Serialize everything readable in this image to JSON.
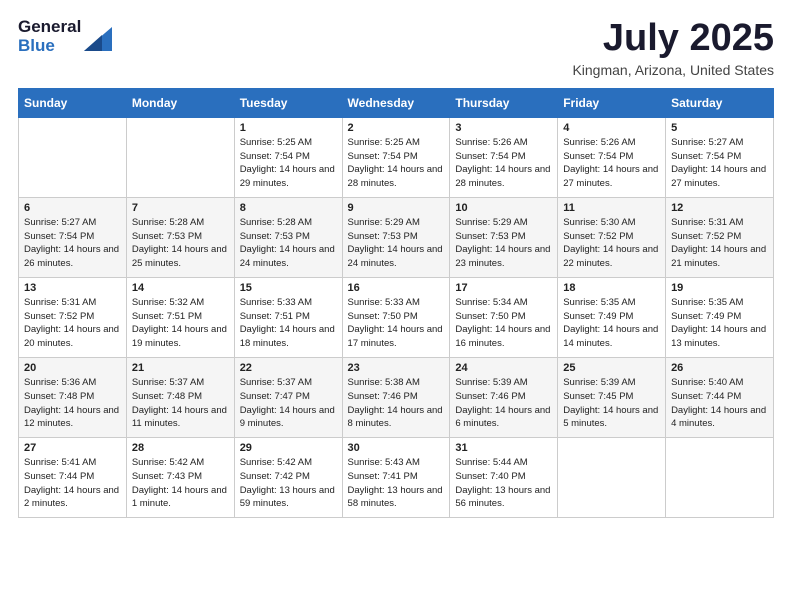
{
  "header": {
    "logo_general": "General",
    "logo_blue": "Blue",
    "month_title": "July 2025",
    "location": "Kingman, Arizona, United States"
  },
  "weekdays": [
    "Sunday",
    "Monday",
    "Tuesday",
    "Wednesday",
    "Thursday",
    "Friday",
    "Saturday"
  ],
  "weeks": [
    [
      {
        "day": "",
        "sunrise": "",
        "sunset": "",
        "daylight": ""
      },
      {
        "day": "",
        "sunrise": "",
        "sunset": "",
        "daylight": ""
      },
      {
        "day": "1",
        "sunrise": "Sunrise: 5:25 AM",
        "sunset": "Sunset: 7:54 PM",
        "daylight": "Daylight: 14 hours and 29 minutes."
      },
      {
        "day": "2",
        "sunrise": "Sunrise: 5:25 AM",
        "sunset": "Sunset: 7:54 PM",
        "daylight": "Daylight: 14 hours and 28 minutes."
      },
      {
        "day": "3",
        "sunrise": "Sunrise: 5:26 AM",
        "sunset": "Sunset: 7:54 PM",
        "daylight": "Daylight: 14 hours and 28 minutes."
      },
      {
        "day": "4",
        "sunrise": "Sunrise: 5:26 AM",
        "sunset": "Sunset: 7:54 PM",
        "daylight": "Daylight: 14 hours and 27 minutes."
      },
      {
        "day": "5",
        "sunrise": "Sunrise: 5:27 AM",
        "sunset": "Sunset: 7:54 PM",
        "daylight": "Daylight: 14 hours and 27 minutes."
      }
    ],
    [
      {
        "day": "6",
        "sunrise": "Sunrise: 5:27 AM",
        "sunset": "Sunset: 7:54 PM",
        "daylight": "Daylight: 14 hours and 26 minutes."
      },
      {
        "day": "7",
        "sunrise": "Sunrise: 5:28 AM",
        "sunset": "Sunset: 7:53 PM",
        "daylight": "Daylight: 14 hours and 25 minutes."
      },
      {
        "day": "8",
        "sunrise": "Sunrise: 5:28 AM",
        "sunset": "Sunset: 7:53 PM",
        "daylight": "Daylight: 14 hours and 24 minutes."
      },
      {
        "day": "9",
        "sunrise": "Sunrise: 5:29 AM",
        "sunset": "Sunset: 7:53 PM",
        "daylight": "Daylight: 14 hours and 24 minutes."
      },
      {
        "day": "10",
        "sunrise": "Sunrise: 5:29 AM",
        "sunset": "Sunset: 7:53 PM",
        "daylight": "Daylight: 14 hours and 23 minutes."
      },
      {
        "day": "11",
        "sunrise": "Sunrise: 5:30 AM",
        "sunset": "Sunset: 7:52 PM",
        "daylight": "Daylight: 14 hours and 22 minutes."
      },
      {
        "day": "12",
        "sunrise": "Sunrise: 5:31 AM",
        "sunset": "Sunset: 7:52 PM",
        "daylight": "Daylight: 14 hours and 21 minutes."
      }
    ],
    [
      {
        "day": "13",
        "sunrise": "Sunrise: 5:31 AM",
        "sunset": "Sunset: 7:52 PM",
        "daylight": "Daylight: 14 hours and 20 minutes."
      },
      {
        "day": "14",
        "sunrise": "Sunrise: 5:32 AM",
        "sunset": "Sunset: 7:51 PM",
        "daylight": "Daylight: 14 hours and 19 minutes."
      },
      {
        "day": "15",
        "sunrise": "Sunrise: 5:33 AM",
        "sunset": "Sunset: 7:51 PM",
        "daylight": "Daylight: 14 hours and 18 minutes."
      },
      {
        "day": "16",
        "sunrise": "Sunrise: 5:33 AM",
        "sunset": "Sunset: 7:50 PM",
        "daylight": "Daylight: 14 hours and 17 minutes."
      },
      {
        "day": "17",
        "sunrise": "Sunrise: 5:34 AM",
        "sunset": "Sunset: 7:50 PM",
        "daylight": "Daylight: 14 hours and 16 minutes."
      },
      {
        "day": "18",
        "sunrise": "Sunrise: 5:35 AM",
        "sunset": "Sunset: 7:49 PM",
        "daylight": "Daylight: 14 hours and 14 minutes."
      },
      {
        "day": "19",
        "sunrise": "Sunrise: 5:35 AM",
        "sunset": "Sunset: 7:49 PM",
        "daylight": "Daylight: 14 hours and 13 minutes."
      }
    ],
    [
      {
        "day": "20",
        "sunrise": "Sunrise: 5:36 AM",
        "sunset": "Sunset: 7:48 PM",
        "daylight": "Daylight: 14 hours and 12 minutes."
      },
      {
        "day": "21",
        "sunrise": "Sunrise: 5:37 AM",
        "sunset": "Sunset: 7:48 PM",
        "daylight": "Daylight: 14 hours and 11 minutes."
      },
      {
        "day": "22",
        "sunrise": "Sunrise: 5:37 AM",
        "sunset": "Sunset: 7:47 PM",
        "daylight": "Daylight: 14 hours and 9 minutes."
      },
      {
        "day": "23",
        "sunrise": "Sunrise: 5:38 AM",
        "sunset": "Sunset: 7:46 PM",
        "daylight": "Daylight: 14 hours and 8 minutes."
      },
      {
        "day": "24",
        "sunrise": "Sunrise: 5:39 AM",
        "sunset": "Sunset: 7:46 PM",
        "daylight": "Daylight: 14 hours and 6 minutes."
      },
      {
        "day": "25",
        "sunrise": "Sunrise: 5:39 AM",
        "sunset": "Sunset: 7:45 PM",
        "daylight": "Daylight: 14 hours and 5 minutes."
      },
      {
        "day": "26",
        "sunrise": "Sunrise: 5:40 AM",
        "sunset": "Sunset: 7:44 PM",
        "daylight": "Daylight: 14 hours and 4 minutes."
      }
    ],
    [
      {
        "day": "27",
        "sunrise": "Sunrise: 5:41 AM",
        "sunset": "Sunset: 7:44 PM",
        "daylight": "Daylight: 14 hours and 2 minutes."
      },
      {
        "day": "28",
        "sunrise": "Sunrise: 5:42 AM",
        "sunset": "Sunset: 7:43 PM",
        "daylight": "Daylight: 14 hours and 1 minute."
      },
      {
        "day": "29",
        "sunrise": "Sunrise: 5:42 AM",
        "sunset": "Sunset: 7:42 PM",
        "daylight": "Daylight: 13 hours and 59 minutes."
      },
      {
        "day": "30",
        "sunrise": "Sunrise: 5:43 AM",
        "sunset": "Sunset: 7:41 PM",
        "daylight": "Daylight: 13 hours and 58 minutes."
      },
      {
        "day": "31",
        "sunrise": "Sunrise: 5:44 AM",
        "sunset": "Sunset: 7:40 PM",
        "daylight": "Daylight: 13 hours and 56 minutes."
      },
      {
        "day": "",
        "sunrise": "",
        "sunset": "",
        "daylight": ""
      },
      {
        "day": "",
        "sunrise": "",
        "sunset": "",
        "daylight": ""
      }
    ]
  ]
}
